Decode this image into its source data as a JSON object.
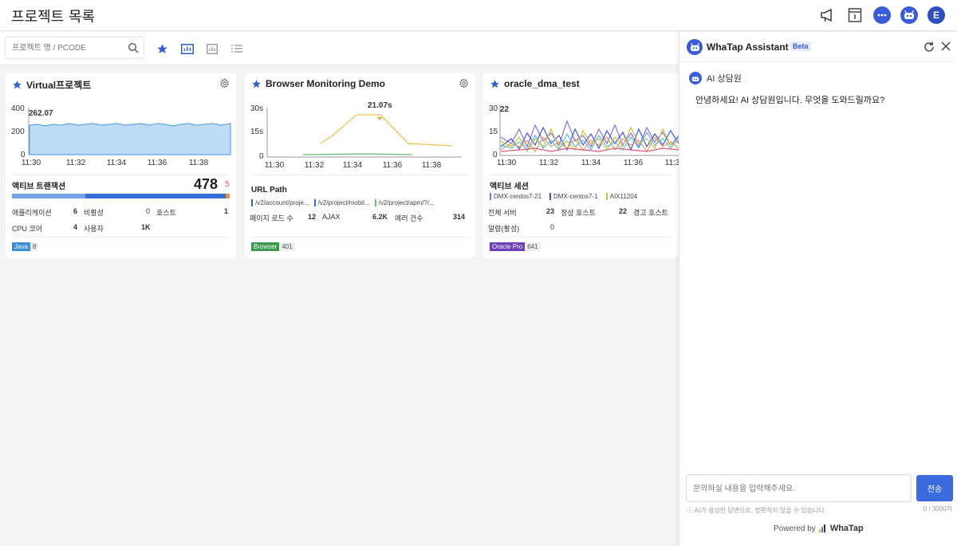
{
  "header": {
    "title": "프로젝트 목록",
    "avatar_letter": "E"
  },
  "toolbar": {
    "search_placeholder": "프로젝트 명 / PCODE"
  },
  "cards": [
    {
      "title": "Virtual프로젝트",
      "chart": {
        "type": "area",
        "y_ticks": [
          "400",
          "200",
          "0"
        ],
        "x_ticks": [
          "11:30",
          "11:32",
          "11:34",
          "11:36",
          "11:38"
        ],
        "peak_label": "262.07"
      },
      "section_title": "액티브 트랜잭션",
      "big_value": "478",
      "small_value": "5",
      "stats": [
        {
          "label": "애플리케이션",
          "value": "6"
        },
        {
          "label": "비활성",
          "value": "0"
        },
        {
          "label": "호스트",
          "value": "1"
        },
        {
          "label": "CPU 코어",
          "value": "4"
        },
        {
          "label": "사용자",
          "value": "1K"
        }
      ],
      "tag": {
        "name": "Java",
        "count": "8",
        "color": "#3d8ed6"
      }
    },
    {
      "title": "Browser Monitoring Demo",
      "chart": {
        "type": "line",
        "y_ticks": [
          "30s",
          "15s",
          "0"
        ],
        "x_ticks": [
          "11:30",
          "11:32",
          "11:34",
          "11:36",
          "11:38"
        ],
        "peak_label": "21.07s"
      },
      "section_title": "URL Path",
      "paths": [
        "/v2/account/proje...",
        "/v2/project/mobil...",
        "/v2/project/apm/?/..."
      ],
      "stats": [
        {
          "label": "페이지 로드 수",
          "value": "12"
        },
        {
          "label": "AJAX",
          "value": "6.2K"
        },
        {
          "label": "에러 건수",
          "value": "314"
        }
      ],
      "tag": {
        "name": "Browser",
        "count": "401",
        "color": "#3a9a4c"
      }
    },
    {
      "title": "oracle_dma_test",
      "chart": {
        "type": "line",
        "y_ticks": [
          "30",
          "15",
          "0"
        ],
        "x_ticks": [
          "11:30",
          "11:32",
          "11:34",
          "11:36",
          "11:3"
        ],
        "peak_label": "22"
      },
      "section_title": "액티브 세션",
      "legend": [
        "DMX-centos7-21",
        "DMX-centos7-1",
        "AIX11204"
      ],
      "stats": [
        {
          "label": "전체 서버",
          "value": "23"
        },
        {
          "label": "정상 호스트",
          "value": "22"
        },
        {
          "label": "경고 호스트",
          "value": ""
        },
        {
          "label": "알람(활성)",
          "value": "0"
        }
      ],
      "tag": {
        "name": "Oracle Pro",
        "count": "641",
        "color": "#6b3fb8"
      }
    }
  ],
  "assistant": {
    "title": "WhaTap Assistant",
    "beta": "Beta",
    "bot_name": "AI 상담원",
    "greeting": "안녕하세요! AI 상담원입니다. 무엇을 도와드릴까요?",
    "input_placeholder": "문의하실 내용을 입력해주세요.",
    "send_label": "전송",
    "disclaimer": "ⓘ AI가 생성한 답변으로, 정확하지 않을 수 있습니다.",
    "char_count": "0 / 3000자",
    "powered_by": "Powered by",
    "brand": "WhaTap"
  }
}
